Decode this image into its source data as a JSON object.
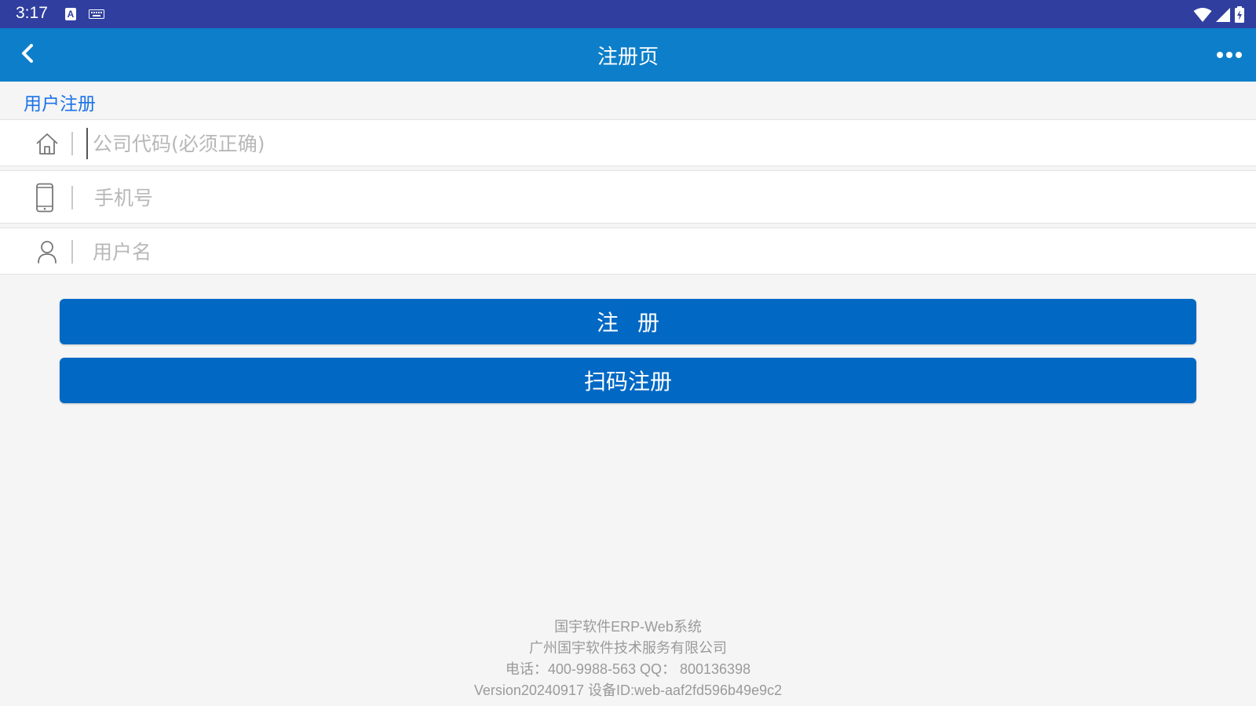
{
  "status_bar": {
    "time": "3:17",
    "input_indicator": "A",
    "icons": [
      "notification-a-icon",
      "keyboard-icon",
      "wifi-icon",
      "signal-icon",
      "battery-charging-icon"
    ]
  },
  "app_bar": {
    "title": "注册页",
    "back_icon": "chevron-left-icon",
    "more_icon": "more-horizontal-icon"
  },
  "section": {
    "title": "用户注册"
  },
  "form": {
    "company_code": {
      "icon": "home-icon",
      "placeholder": "公司代码(必须正确)",
      "value": ""
    },
    "phone": {
      "icon": "mobile-phone-icon",
      "placeholder": "手机号",
      "value": ""
    },
    "username": {
      "icon": "user-icon",
      "placeholder": "用户名",
      "value": ""
    }
  },
  "buttons": {
    "register": "注册",
    "scan_register": "扫码注册"
  },
  "footer": {
    "line1": "国宇软件ERP-Web系统",
    "line2": "广州国宇软件技术服务有限公司",
    "line3": "电话：400-9988-563 QQ： 800136398",
    "line4": "Version20240917 设备ID:web-aaf2fd596b49e9c2"
  },
  "colors": {
    "status_bar": "#303f9f",
    "app_bar": "#0d7fca",
    "primary_button": "#0168c4",
    "section_title": "#1b72e8"
  }
}
